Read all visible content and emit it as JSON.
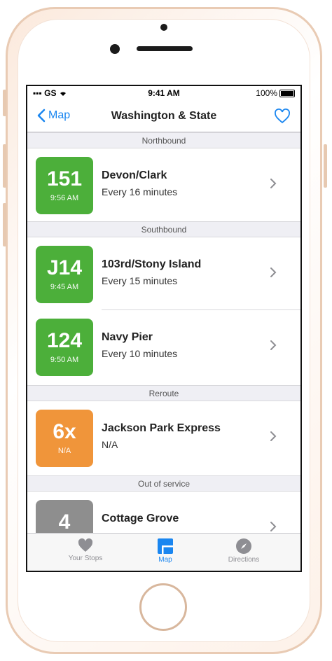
{
  "status_bar": {
    "carrier": "GS",
    "time": "9:41 AM",
    "battery": "100%"
  },
  "nav": {
    "back_label": "Map",
    "title": "Washington & State"
  },
  "sections": [
    {
      "label": "Northbound",
      "routes": [
        {
          "number": "151",
          "time": "9:56 AM",
          "name": "Devon/Clark",
          "frequency": "Every 16 minutes",
          "color": "#4caf3a"
        }
      ]
    },
    {
      "label": "Southbound",
      "routes": [
        {
          "number": "J14",
          "time": "9:45 AM",
          "name": "103rd/Stony Island",
          "frequency": "Every 15 minutes",
          "color": "#4caf3a"
        },
        {
          "number": "124",
          "time": "9:50 AM",
          "name": "Navy Pier",
          "frequency": "Every 10 minutes",
          "color": "#4caf3a"
        }
      ]
    },
    {
      "label": "Reroute",
      "routes": [
        {
          "number": "6x",
          "time": "N/A",
          "name": "Jackson Park Express",
          "frequency": "N/A",
          "color": "#f0953a"
        }
      ]
    },
    {
      "label": "Out of service",
      "routes": [
        {
          "number": "4",
          "time": "",
          "name": "Cottage Grove",
          "frequency": "",
          "color": "#8e8e8e"
        }
      ]
    }
  ],
  "tabs": [
    {
      "label": "Your Stops",
      "icon": "heart-icon",
      "active": false
    },
    {
      "label": "Map",
      "icon": "map-icon",
      "active": true
    },
    {
      "label": "Directions",
      "icon": "compass-icon",
      "active": false
    }
  ],
  "colors": {
    "accent": "#1a86f0",
    "green": "#4caf3a",
    "orange": "#f0953a",
    "gray": "#8e8e8e"
  }
}
